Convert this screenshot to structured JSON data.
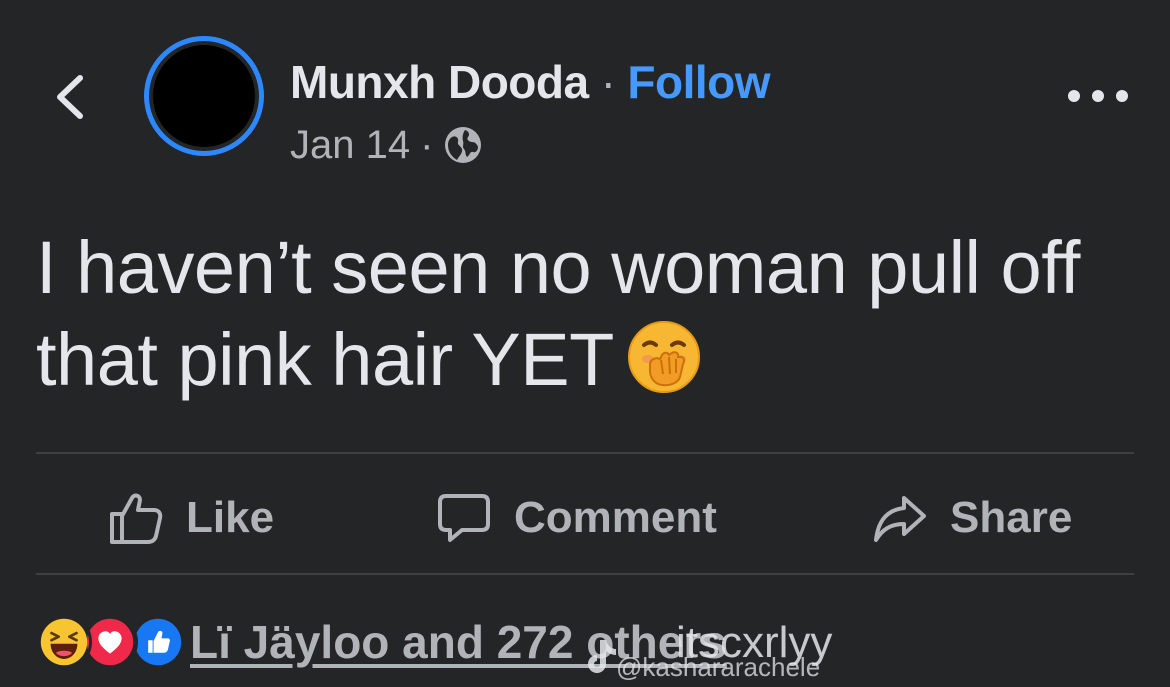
{
  "post": {
    "author_name": "Munxh Dooda",
    "separator": "·",
    "follow_label": "Follow",
    "timestamp": "Jan 14",
    "meta_separator": "·",
    "audience_icon": "globe-icon",
    "text": "I haven’t seen no woman pull off that pink hair YET",
    "emoji": "face-with-hand-over-mouth-emoji"
  },
  "actions": {
    "like_label": "Like",
    "comment_label": "Comment",
    "share_label": "Share"
  },
  "reactions": {
    "icons": [
      "haha-reaction-icon",
      "love-reaction-icon",
      "like-reaction-icon"
    ],
    "summary": "Lï Jäyloo and 272 others"
  },
  "watermark": {
    "handle": "itscxrlyy",
    "sub": "@kashararachele"
  },
  "colors": {
    "background": "#242526",
    "primary_text": "#e4e6eb",
    "secondary_text": "#b0b3b8",
    "accent": "#4599ff",
    "avatar_ring": "#2d88ff",
    "divider": "#3e4042"
  }
}
